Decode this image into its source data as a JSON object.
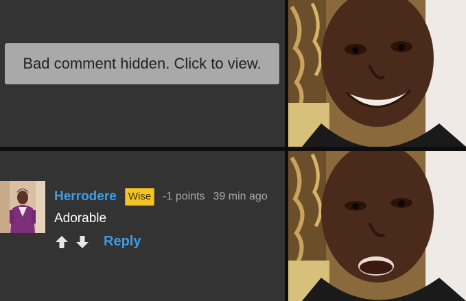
{
  "hidden_comment": {
    "text": "Bad comment hidden. Click to view."
  },
  "comment": {
    "username": "Herrodere",
    "badge": "Wise",
    "points": "-1 points",
    "time": "39 min ago",
    "text": "Adorable",
    "reply_label": "Reply",
    "icons": {
      "upvote": "arrow-up-icon",
      "downvote": "arrow-down-icon"
    }
  },
  "colors": {
    "username": "#3f9de8",
    "badge_bg": "#f2c524",
    "panel_bg": "#333333",
    "hidden_box_bg": "#a9a9a9"
  }
}
